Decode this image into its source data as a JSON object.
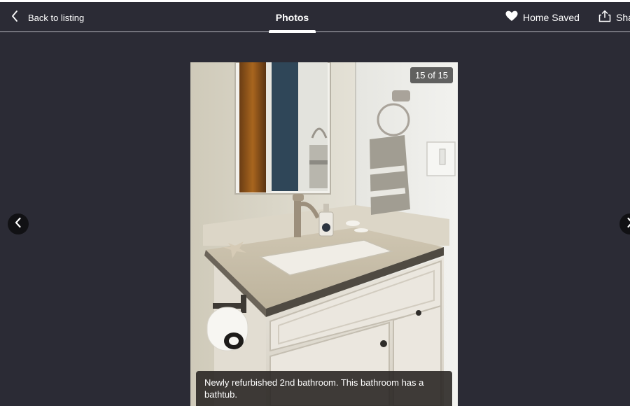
{
  "header": {
    "back_label": "Back to listing",
    "tab_label": "Photos",
    "saved_label": "Home Saved",
    "share_label": "Share"
  },
  "viewer": {
    "counter": "15 of 15",
    "caption": "Newly refurbished 2nd bathroom. This bathroom has a bathtub.",
    "current_photo": 15,
    "total_photos": 15
  },
  "icons": {
    "back": "chevron-left-icon",
    "saved": "heart-icon",
    "share": "share-icon",
    "prev": "chevron-left-icon",
    "next": "chevron-right-icon"
  },
  "colors": {
    "background": "#2b2b35",
    "text": "#ffffff",
    "nav_button": "#111114"
  }
}
